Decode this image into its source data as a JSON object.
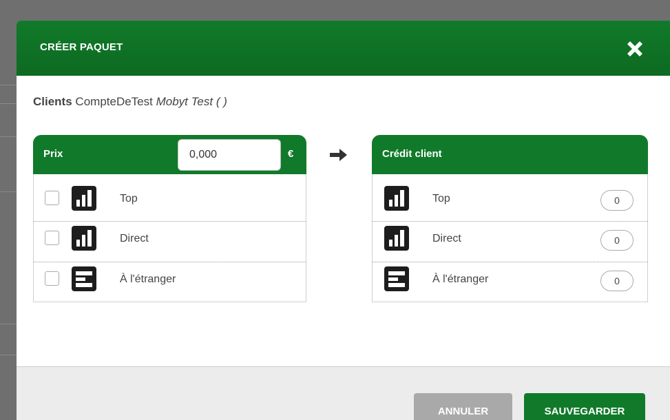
{
  "dialog": {
    "title": "CRÉER PAQUET",
    "close_icon": "close-icon"
  },
  "client": {
    "label": "Clients",
    "account": "CompteDeTest",
    "detail": "Mobyt Test ( )"
  },
  "price_panel": {
    "title": "Prix",
    "price_value": "0,000",
    "currency": "€",
    "items": [
      {
        "label": "Top",
        "icon": "signal-bars-icon",
        "checked": false
      },
      {
        "label": "Direct",
        "icon": "signal-bars-icon",
        "checked": false
      },
      {
        "label": "À l'étranger",
        "icon": "foreign-card-icon",
        "checked": false
      }
    ]
  },
  "arrow_icon": "arrow-right-icon",
  "credit_panel": {
    "title": "Crédit client",
    "items": [
      {
        "label": "Top",
        "icon": "signal-bars-icon",
        "value": "0"
      },
      {
        "label": "Direct",
        "icon": "signal-bars-icon",
        "value": "0"
      },
      {
        "label": "À l'étranger",
        "icon": "foreign-card-icon",
        "value": "0"
      }
    ]
  },
  "footer": {
    "cancel_label": "ANNULER",
    "save_label": "SAUVEGARDER"
  },
  "colors": {
    "primary_green": "#117a2a",
    "cancel_gray": "#a9a9a9"
  }
}
